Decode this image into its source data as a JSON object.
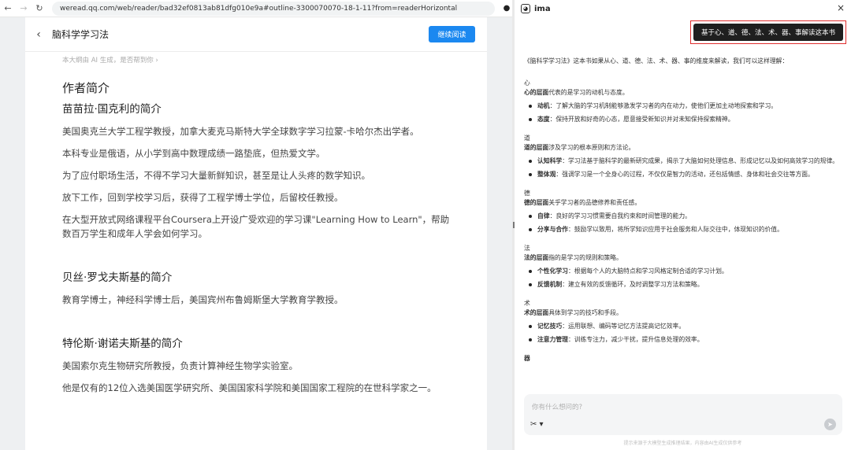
{
  "browser": {
    "url": "weread.qq.com/web/reader/bad32ef0813ab81dfg010e9a#outline-3300070070-18-1-11?from=readerHorizontal"
  },
  "reader": {
    "book_title": "脑科学学习法",
    "continue_label": "继续阅读",
    "ai_note": "本大纲由 AI 生成，是否帮到你 ›",
    "section_title": "作者简介",
    "authors": [
      {
        "name": "苗苗拉·国克利的简介",
        "paragraphs": [
          "美国奥克兰大学工程学教授，加拿大麦克马斯特大学全球数字学习拉蒙-卡哈尔杰出学者。",
          "本科专业是俄语，从小学到高中数理成绩一路垫底，但热爱文学。",
          "为了应付职场生活，不得不学习大量新鲜知识，甚至是让人头疼的数学知识。",
          "放下工作，回到学校学习后，获得了工程学博士学位，后留校任教授。",
          "在大型开放式网络课程平台Coursera上开设广受欢迎的学习课\"Learning How to Learn\"，帮助数百万学生和成年人学会如何学习。"
        ]
      },
      {
        "name": "贝丝·罗戈夫斯基的简介",
        "paragraphs": [
          "教育学博士，神经科学博士后，美国宾州布鲁姆斯堡大学教育学教授。"
        ]
      },
      {
        "name": "特伦斯·谢诺夫斯基的简介",
        "paragraphs": [
          "美国索尔克生物研究所教授，负责计算神经生物学实验室。",
          "他是仅有的12位入选美国医学研究所、美国国家科学院和美国国家工程院的在世科学家之一。"
        ]
      }
    ]
  },
  "panel": {
    "brand": "ima",
    "close": "×",
    "prompt": "基于心、道、德、法、术、器、事解读这本书",
    "intro": "《脑科学学习法》这本书如果从心、道、德、法、术、器、事的维度来解读，我们可以这样理解：",
    "sections": [
      {
        "label": "心",
        "head_bold": "心的层面",
        "head_rest": "代表的是学习的动机与态度。",
        "items": [
          {
            "k": "动机",
            "v": "：了解大脑的学习机制能够激发学习者的内在动力，使他们更加主动地探索和学习。"
          },
          {
            "k": "态度",
            "v": "：保持开放和好奇的心态，愿意接受新知识并对未知保持探索精神。"
          }
        ]
      },
      {
        "label": "道",
        "head_bold": "道的层面",
        "head_rest": "涉及学习的根本原则和方法论。",
        "items": [
          {
            "k": "认知科学",
            "v": "：学习法基于脑科学的最新研究成果，揭示了大脑如何处理信息、形成记忆以及如何高效学习的规律。"
          },
          {
            "k": "整体观",
            "v": "：强调学习是一个全身心的过程，不仅仅是智力的活动，还包括情感、身体和社会交往等方面。"
          }
        ]
      },
      {
        "label": "德",
        "head_bold": "德的层面",
        "head_rest": "关乎学习者的品德修养和责任感。",
        "items": [
          {
            "k": "自律",
            "v": "：良好的学习习惯需要自我约束和时间管理的能力。"
          },
          {
            "k": "分享与合作",
            "v": "：鼓励学以致用，将所学知识应用于社会服务和人际交往中，体现知识的价值。"
          }
        ]
      },
      {
        "label": "法",
        "head_bold": "法的层面",
        "head_rest": "指的是学习的规则和策略。",
        "items": [
          {
            "k": "个性化学习",
            "v": "：根据每个人的大脑特点和学习风格定制合适的学习计划。"
          },
          {
            "k": "反馈机制",
            "v": "：建立有效的反馈循环，及时调整学习方法和策略。"
          }
        ]
      },
      {
        "label": "术",
        "head_bold": "术的层面",
        "head_rest": "具体到学习的技巧和手段。",
        "items": [
          {
            "k": "记忆技巧",
            "v": "：运用联想、编码等记忆方法提高记忆效率。"
          },
          {
            "k": "注意力管理",
            "v": "：训练专注力，减少干扰，提升信息处理的效率。"
          }
        ]
      },
      {
        "label": "器",
        "head_bold": "",
        "head_rest": "",
        "items": []
      }
    ],
    "input_placeholder": "你有什么想问的?",
    "footer_note": "提示来源于大模型生成推理结果，内容由AI生成仅供参考"
  }
}
